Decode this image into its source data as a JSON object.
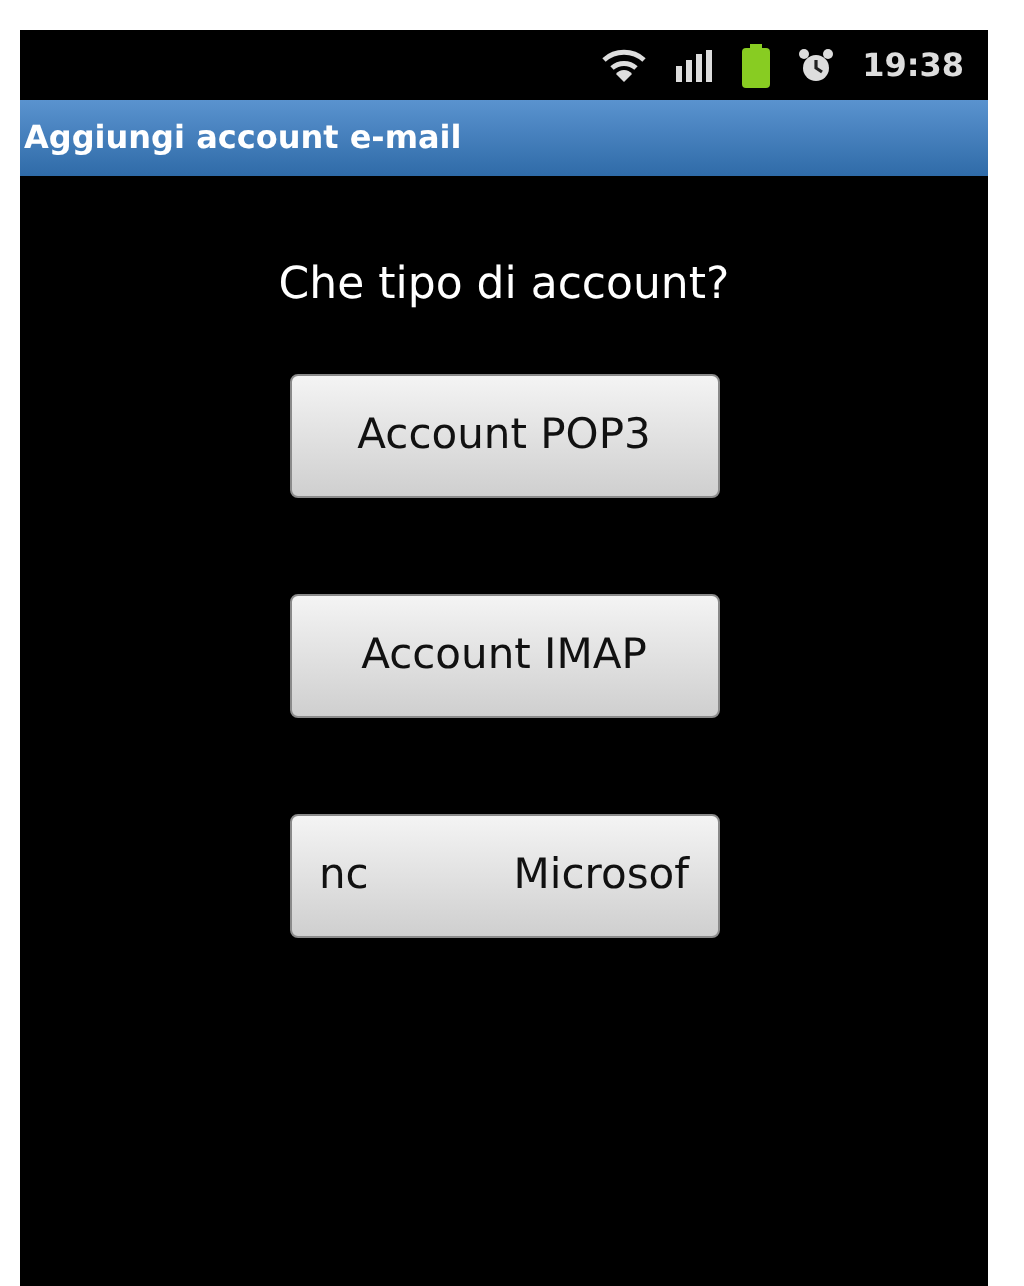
{
  "status_bar": {
    "time": "19:38"
  },
  "title_bar": {
    "title": "Aggiungi account e-mail"
  },
  "heading": "Che tipo di account?",
  "buttons": [
    {
      "kind": "plain",
      "label": "Account POP3"
    },
    {
      "kind": "plain",
      "label": "Account IMAP"
    },
    {
      "kind": "scrolling",
      "parts": [
        "nc",
        "Microsof"
      ]
    }
  ]
}
